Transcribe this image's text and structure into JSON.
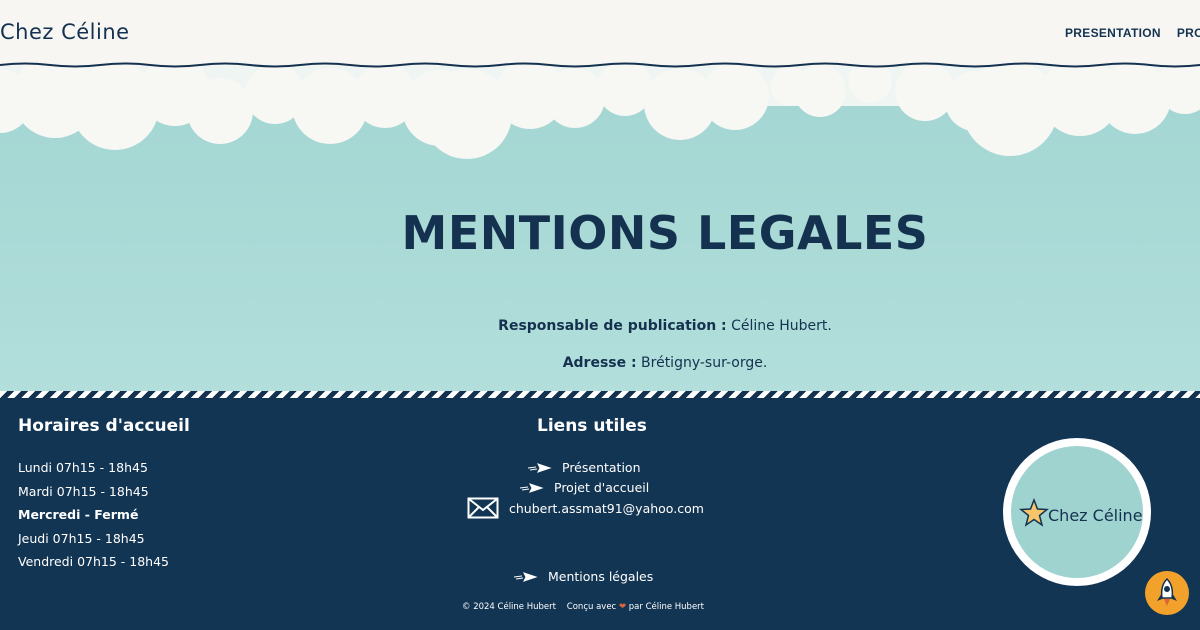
{
  "header": {
    "brand": "Chez Céline",
    "nav": [
      "PRESENTATION",
      "PROJ"
    ]
  },
  "hero": {
    "title": "MENTIONS LEGALES",
    "publisher_label": "Responsable de publication :",
    "publisher_value": " Céline Hubert.",
    "address_label": "Adresse :",
    "address_value": " Brétigny-sur-orge."
  },
  "footer": {
    "hours_title": "Horaires d'accueil",
    "hours": [
      "Lundi 07h15 - 18h45",
      "Mardi 07h15 - 18h45",
      "Mercredi - Fermé",
      "Jeudi 07h15 - 18h45",
      "Vendredi 07h15 - 18h45"
    ],
    "links_title": "Liens utiles",
    "links": {
      "presentation": "Présentation",
      "projet": "Projet d'accueil",
      "email": "chubert.assmat91@yahoo.com",
      "mentions": "Mentions légales"
    },
    "copyright": "© 2024 Céline Hubert",
    "made_with": "Conçu avec",
    "heart": "❤",
    "made_by": "par Céline Hubert",
    "logo_text": "Chez Céline"
  },
  "colors": {
    "navy": "#14324f",
    "teal": "#a4d6d3",
    "accent_orange": "#f2a22a",
    "heart_red": "#e0643a"
  },
  "icons": [
    "paper-plane-icon",
    "envelope-icon",
    "star-icon",
    "rocket-icon"
  ]
}
